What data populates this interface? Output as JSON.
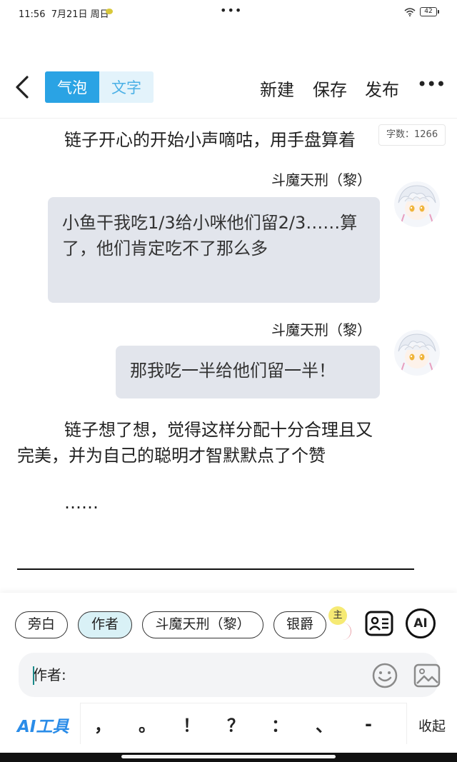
{
  "status_bar": {
    "time": "11:56",
    "date": "7月21日 周日",
    "battery": "42"
  },
  "toolbar": {
    "mode_bubble": "气泡",
    "mode_text": "文字",
    "new_label": "新建",
    "save_label": "保存",
    "publish_label": "发布",
    "more_label": "•••"
  },
  "editor": {
    "word_count": "字数：1266",
    "paragraph1": "链子开心的开始小声嘀咕，用手盘算着",
    "messages": [
      {
        "speaker": "斗魔天刑（黎）",
        "text": "小鱼干我吃1/3给小咪他们留2/3……算了，他们肯定吃不了那么多"
      },
      {
        "speaker": "斗魔天刑（黎）",
        "text": "那我吃一半给他们留一半！"
      }
    ],
    "paragraph2_line1": "链子想了想，觉得这样分配十分合理且又",
    "paragraph2_line2": "完美，并为自己的聪明才智默默点了个赞",
    "ellipsis": "……"
  },
  "roles": {
    "narration": "旁白",
    "author": "作者",
    "character1": "斗魔天刑（黎）",
    "character2": "银爵",
    "host_badge": "主"
  },
  "input": {
    "value": "作者:"
  },
  "bottom": {
    "ai_tools": "AI工具",
    "punctuation": [
      "，",
      "。",
      "！",
      "？",
      "：",
      "、",
      "-",
      "~"
    ],
    "collapse": "收起",
    "ai_button": "AI"
  },
  "colors": {
    "accent": "#2aa3e4",
    "bubble_bg": "#e2e5ec",
    "ai_tools": "#2a8ce8"
  }
}
